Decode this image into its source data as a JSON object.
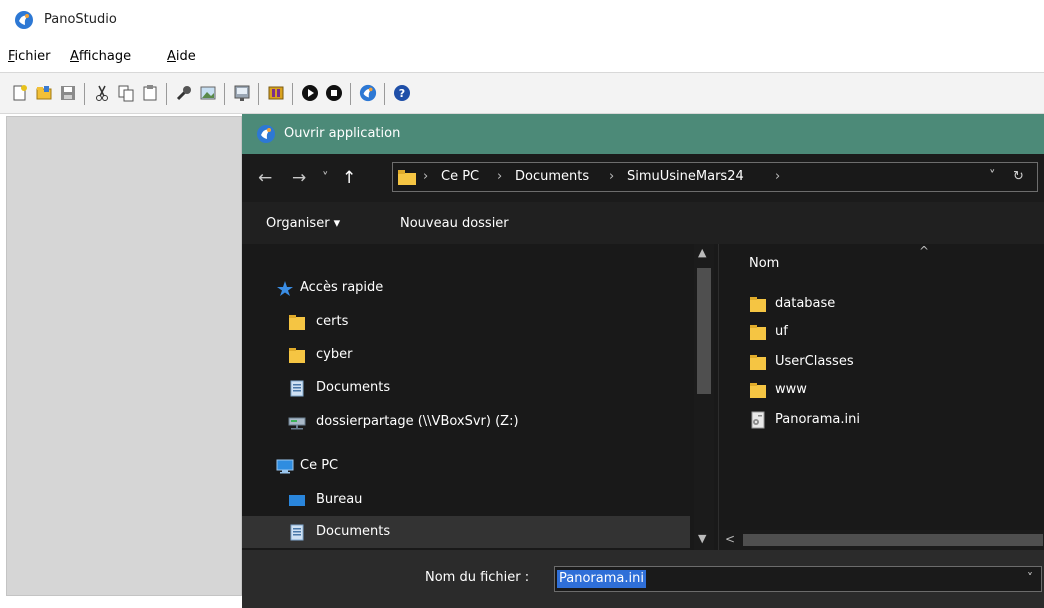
{
  "app": {
    "title": "PanoStudio"
  },
  "menu": {
    "fichier": {
      "accel": "F",
      "rest": "ichier"
    },
    "affichage": {
      "accel": "A",
      "rest": "ffichage"
    },
    "aide": {
      "accel": "A",
      "rest": "ide"
    }
  },
  "dialog": {
    "title": "Ouvrir application",
    "nav": {
      "back": "←",
      "forward": "→",
      "recent": "˅",
      "up": "↑"
    },
    "breadcrumb": {
      "sep": "›",
      "items": [
        "Ce PC",
        "Documents",
        "SimuUsineMars24"
      ],
      "dropdown": "˅",
      "refresh": "↻"
    },
    "commands": {
      "organize": "Organiser ▾",
      "new_folder": "Nouveau dossier"
    },
    "nav_pane": {
      "items": [
        {
          "label": "Accès rapide",
          "icon": "star-icon"
        },
        {
          "label": "certs",
          "icon": "folder-icon"
        },
        {
          "label": "cyber",
          "icon": "folder-icon"
        },
        {
          "label": "Documents",
          "icon": "documents-icon"
        },
        {
          "label": "dossierpartage (\\\\VBoxSvr) (Z:)",
          "icon": "network-drive-icon"
        },
        {
          "label": "Ce PC",
          "icon": "computer-icon"
        },
        {
          "label": "Bureau",
          "icon": "desktop-icon"
        },
        {
          "label": "Documents",
          "icon": "documents-icon"
        }
      ],
      "selected_index": 7
    },
    "file_list": {
      "column": "Nom",
      "items": [
        {
          "name": "database",
          "icon": "folder-icon"
        },
        {
          "name": "uf",
          "icon": "folder-icon"
        },
        {
          "name": "UserClasses",
          "icon": "folder-icon"
        },
        {
          "name": "www",
          "icon": "folder-icon"
        },
        {
          "name": "Panorama.ini",
          "icon": "ini-file-icon"
        }
      ]
    },
    "filename": {
      "label": "Nom du fichier :",
      "value": "Panorama.ini"
    }
  },
  "colors": {
    "dialog_title_bar": "#4c8a78",
    "dialog_background": "#1e1e1e",
    "selection": "#2f6fd8",
    "folder": "#f5c543",
    "workspace": "#d6d6d6"
  }
}
